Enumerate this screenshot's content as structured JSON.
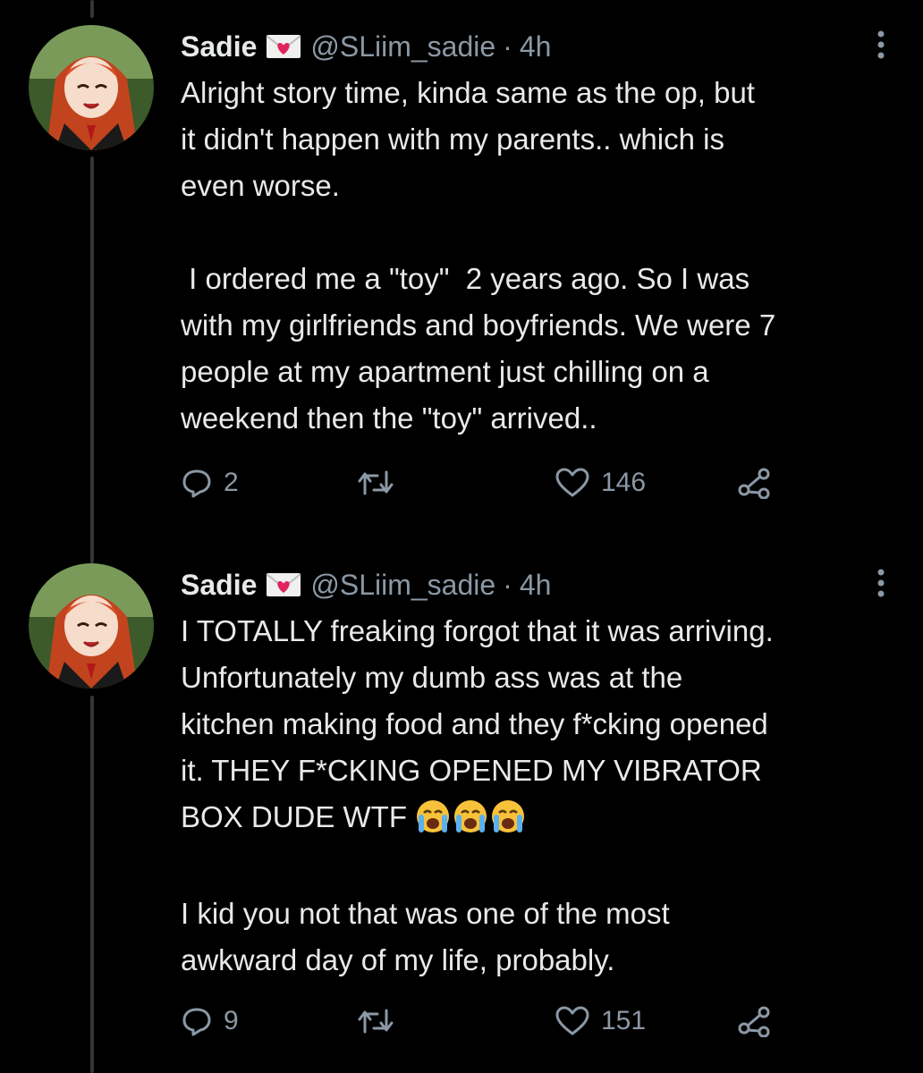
{
  "tweets": [
    {
      "name": "Sadie",
      "handle": "@SLiim_sadie",
      "separator": "·",
      "time": "4h",
      "text": "Alright story time, kinda same as the op, but\nit didn't happen with my parents.. which is\neven worse.\n\n I ordered me a \"toy\"  2 years ago. So I was\nwith my girlfriends and boyfriends. We were 7\npeople at my apartment just chilling on a\nweekend then the \"toy\" arrived..",
      "replies": "2",
      "retweets": "",
      "likes": "146"
    },
    {
      "name": "Sadie",
      "handle": "@SLiim_sadie",
      "separator": "·",
      "time": "4h",
      "text": "I TOTALLY freaking forgot that it was arriving.\nUnfortunately my dumb ass was at the\nkitchen making food and they f*cking opened\nit. THEY F*CKING OPENED MY VIBRATOR\nBOX DUDE WTF ",
      "text_after": "I kid you not that was one of the most\nawkward day of my life, probably.",
      "emoji": [
        "loudly-crying-face",
        "loudly-crying-face",
        "loudly-crying-face"
      ],
      "replies": "9",
      "retweets": "",
      "likes": "151"
    }
  ],
  "colors": {
    "text": "#e7e9ea",
    "muted": "#8b98a5",
    "background": "#000000",
    "badge_heart": "#e0245e"
  }
}
